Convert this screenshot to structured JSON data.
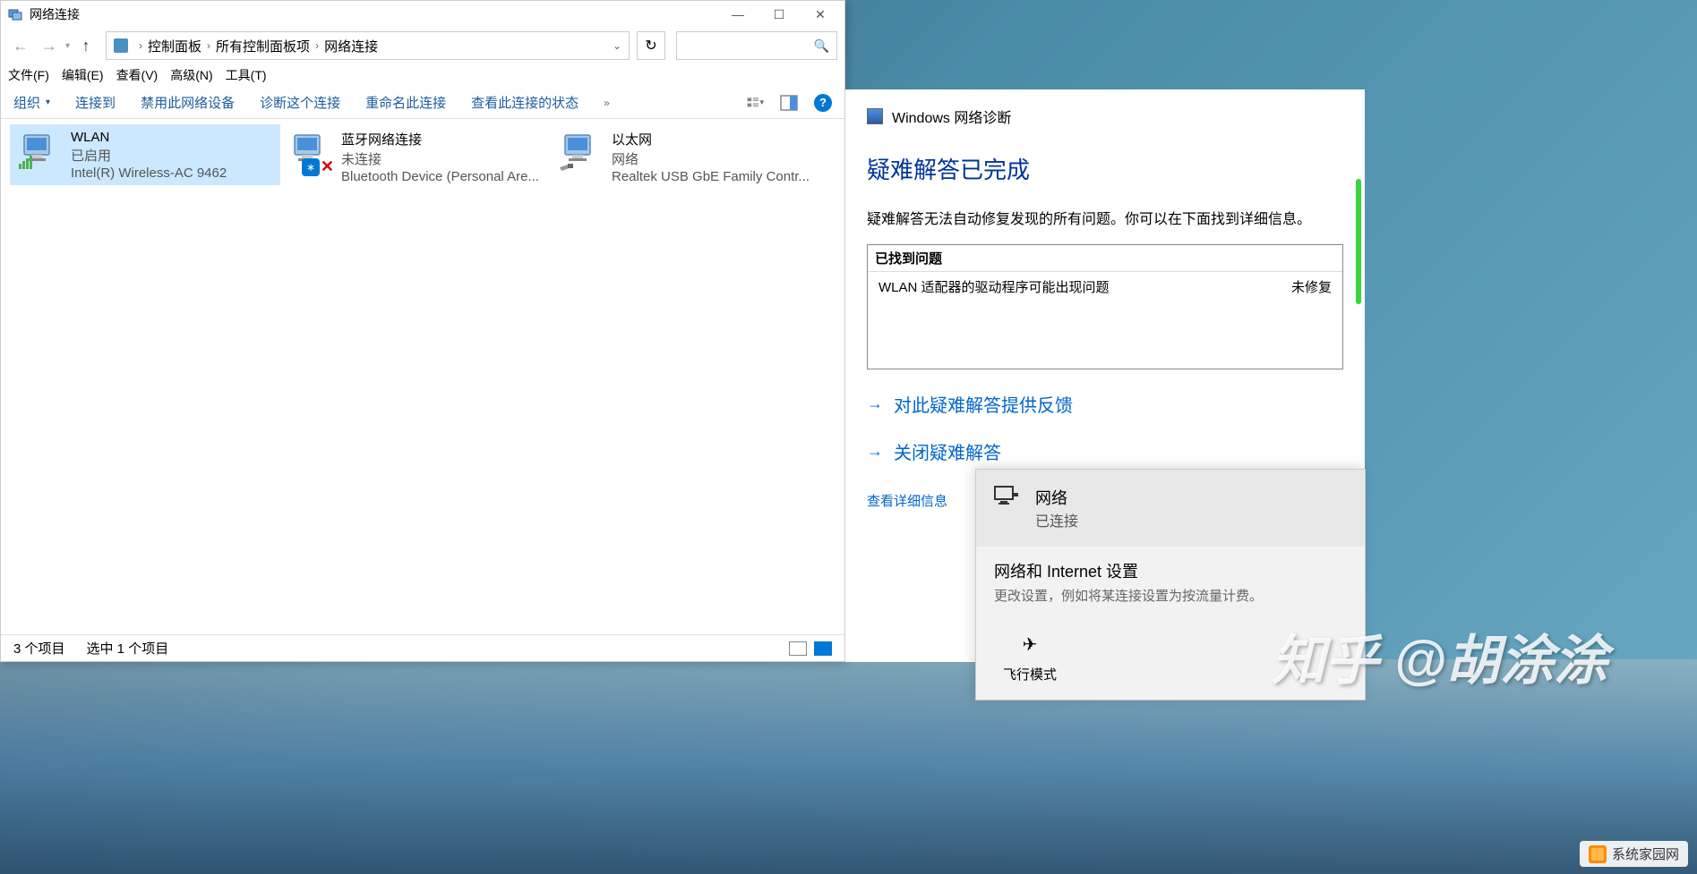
{
  "window": {
    "title": "网络连接",
    "titlebar_icons": {
      "minimize": "—",
      "maximize": "☐",
      "close": "✕"
    }
  },
  "nav": {
    "back": "←",
    "forward": "→",
    "up": "↑",
    "refresh": "↻",
    "breadcrumb": [
      "控制面板",
      "所有控制面板项",
      "网络连接"
    ]
  },
  "menubar": [
    "文件(F)",
    "编辑(E)",
    "查看(V)",
    "高级(N)",
    "工具(T)"
  ],
  "toolbar": {
    "items": [
      "组织",
      "连接到",
      "禁用此网络设备",
      "诊断这个连接",
      "重命名此连接",
      "查看此连接的状态"
    ],
    "overflow": "»",
    "help": "?"
  },
  "connections": [
    {
      "name": "WLAN",
      "status": "已启用",
      "device": "Intel(R) Wireless-AC 9462",
      "selected": true,
      "badge": "signal"
    },
    {
      "name": "蓝牙网络连接",
      "status": "未连接",
      "device": "Bluetooth Device (Personal Are...",
      "selected": false,
      "badge": "bt-disabled"
    },
    {
      "name": "以太网",
      "status": "网络",
      "device": "Realtek USB GbE Family Contr...",
      "selected": false,
      "badge": "cable"
    }
  ],
  "statusbar": {
    "count": "3 个项目",
    "selection": "选中 1 个项目"
  },
  "troubleshooter": {
    "head": "Windows 网络诊断",
    "title": "疑难解答已完成",
    "desc": "疑难解答无法自动修复发现的所有问题。你可以在下面找到详细信息。",
    "problems_head": "已找到问题",
    "problems": [
      {
        "text": "WLAN 适配器的驱动程序可能出现问题",
        "status": "未修复"
      }
    ],
    "link_feedback": "对此疑难解答提供反馈",
    "link_close": "关闭疑难解答",
    "link_detail": "查看详细信息"
  },
  "flyout": {
    "net_name": "网络",
    "net_status": "已连接",
    "settings_title": "网络和 Internet 设置",
    "settings_desc": "更改设置，例如将某连接设置为按流量计费。",
    "airplane": "飞行模式"
  },
  "watermarks": {
    "zhihu": "知乎 @胡涂涂",
    "site": "系统家园网"
  }
}
